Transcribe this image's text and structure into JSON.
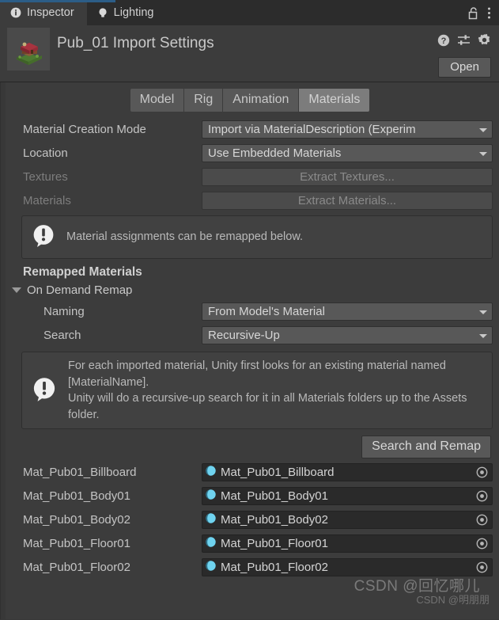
{
  "window": {
    "tabs": [
      {
        "label": "Inspector",
        "icon": "info-circle-icon",
        "active": true
      },
      {
        "label": "Lighting",
        "icon": "lightbulb-icon",
        "active": false
      }
    ],
    "lock_icon": "padlock-unlocked-icon",
    "menu_icon": "kebab-menu-icon",
    "accent_color": "#2c5d87"
  },
  "header": {
    "title": "Pub_01 Import Settings",
    "thumbnail": "model-thumbnail",
    "help_icon": "help-question-icon",
    "preset_icon": "preset-sliders-icon",
    "settings_icon": "gear-icon",
    "open_label": "Open"
  },
  "importer_tabs": [
    {
      "label": "Model",
      "selected": false
    },
    {
      "label": "Rig",
      "selected": false
    },
    {
      "label": "Animation",
      "selected": false
    },
    {
      "label": "Materials",
      "selected": true
    }
  ],
  "settings": {
    "material_creation_mode": {
      "label": "Material Creation Mode",
      "value": "Import via MaterialDescription (Experim",
      "full_value": "Import via MaterialDescription (Experimental)"
    },
    "location": {
      "label": "Location",
      "value": "Use Embedded Materials"
    },
    "textures": {
      "label": "Textures",
      "button": "Extract Textures...",
      "disabled": true
    },
    "materials": {
      "label": "Materials",
      "button": "Extract Materials...",
      "disabled": true
    }
  },
  "info_box": {
    "icon": "info-bubble-icon",
    "text": "Material assignments can be remapped below."
  },
  "remapped": {
    "section_title": "Remapped Materials",
    "foldout_label": "On Demand Remap",
    "foldout_expanded": true,
    "naming": {
      "label": "Naming",
      "value": "From Model's Material"
    },
    "search": {
      "label": "Search",
      "value": "Recursive-Up"
    },
    "help_box": {
      "icon": "info-bubble-icon",
      "text": "For each imported material, Unity first looks for an existing material named [MaterialName].\nUnity will do a recursive-up search for it in all Materials folders up to the Assets folder."
    },
    "search_remap_button": "Search and Remap"
  },
  "material_rows": [
    {
      "name": "Mat_Pub01_Billboard",
      "assigned": "Mat_Pub01_Billboard",
      "icon": "material-sphere-icon",
      "picker": "object-picker-icon"
    },
    {
      "name": "Mat_Pub01_Body01",
      "assigned": "Mat_Pub01_Body01",
      "icon": "material-sphere-icon",
      "picker": "object-picker-icon"
    },
    {
      "name": "Mat_Pub01_Body02",
      "assigned": "Mat_Pub01_Body02",
      "icon": "material-sphere-icon",
      "picker": "object-picker-icon"
    },
    {
      "name": "Mat_Pub01_Floor01",
      "assigned": "Mat_Pub01_Floor01",
      "icon": "material-sphere-icon",
      "picker": "object-picker-icon"
    },
    {
      "name": "Mat_Pub01_Floor02",
      "assigned": "Mat_Pub01_Floor02",
      "icon": "material-sphere-icon",
      "picker": "object-picker-icon"
    }
  ],
  "watermark": {
    "line1": "CSDN @回忆哪儿",
    "line2": "CSDN @明朋朋"
  }
}
